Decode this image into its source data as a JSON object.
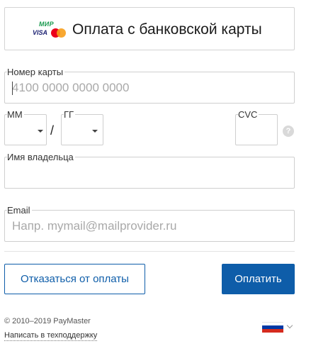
{
  "header": {
    "title": "Оплата с банковской карты",
    "logos": {
      "mir": "МИР",
      "visa": "VISA",
      "mastercard_colors": [
        "#eb001b",
        "#f79e1b"
      ]
    }
  },
  "form": {
    "card_number": {
      "label": "Номер карты",
      "placeholder": "4100 0000 0000 0000",
      "value": ""
    },
    "month": {
      "label": "ММ",
      "value": ""
    },
    "separator": "/",
    "year": {
      "label": "ГГ",
      "value": ""
    },
    "cvc": {
      "label": "CVC",
      "value": "",
      "help_icon": "question-icon",
      "help_glyph": "?"
    },
    "holder": {
      "label": "Имя владельца",
      "value": ""
    },
    "email": {
      "label": "Email",
      "placeholder": "Напр. mymail@mailprovider.ru",
      "value": ""
    }
  },
  "actions": {
    "cancel_label": "Отказаться от оплаты",
    "pay_label": "Оплатить"
  },
  "footer": {
    "copyright": "© 2010–2019 PayMaster",
    "support_link": "Написать в техподдержку",
    "language_flag": "ru-flag-icon"
  },
  "colors": {
    "accent": "#0e5da9",
    "border": "#cfcfcf",
    "placeholder": "#a9a9a9"
  }
}
